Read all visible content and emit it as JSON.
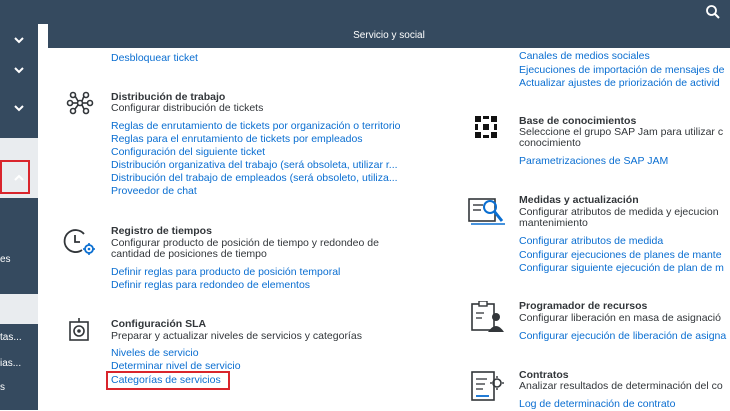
{
  "header": {
    "title": "Servicio y social"
  },
  "colors": {
    "shell": "#354a5f",
    "link": "#0a6ed1",
    "text": "#32363a",
    "highlight": "#d9252c"
  },
  "sidebar": {
    "items": [
      {
        "label": "",
        "icon": "chevron-down-icon"
      },
      {
        "label": "",
        "icon": "chevron-down-icon"
      },
      {
        "label": "",
        "icon": "chevron-down-icon"
      },
      {
        "label": "...",
        "icon": "chevron-down-icon"
      },
      {
        "label": "",
        "icon": "chevron-up-icon"
      }
    ],
    "fragments": [
      "es",
      "tas...",
      "ias...",
      "s"
    ]
  },
  "left_column": {
    "top_links": [
      "Desbloquear ticket"
    ],
    "distribucion": {
      "icon": "network-icon",
      "title": "Distribución de trabajo",
      "subtitle": "Configurar distribución de tickets",
      "links": [
        "Reglas de enrutamiento de tickets por organización o territorio",
        "Reglas para el enrutamiento de tickets por empleados",
        "Configuración del siguiente ticket",
        "Distribución organizativa del trabajo (será obsoleta, utilizar r...",
        "Distribución del trabajo de empleados (será obsoleto, utiliza...",
        "Proveedor de chat"
      ]
    },
    "registro": {
      "icon": "time-settings-icon",
      "title": "Registro de tiempos",
      "subtitle_1": "Configurar producto de posición de tiempo y redondeo de",
      "subtitle_2": "cantidad de posiciones de tiempo",
      "links": [
        "Definir reglas para producto de posición temporal",
        "Definir reglas para redondeo de elementos"
      ]
    },
    "sla": {
      "icon": "target-icon",
      "title": "Configuración SLA",
      "subtitle": "Preparar y actualizar niveles de servicios y categorías",
      "links": [
        "Niveles de servicio",
        "Determinar nivel de servicio",
        "Categorías de servicios"
      ]
    }
  },
  "right_column": {
    "top_links": [
      "Canales de medios sociales",
      "Ejecuciones de importación de mensajes de",
      "Actualizar ajustes de priorización de activid"
    ],
    "conocimientos": {
      "icon": "sap-jam-icon",
      "title": "Base de conocimientos",
      "subtitle_1": "Seleccione el grupo SAP Jam para utilizar c",
      "subtitle_2": "conocimiento",
      "links": [
        "Parametrizaciones de SAP JAM"
      ]
    },
    "medidas": {
      "icon": "measure-icon",
      "title": "Medidas y actualización",
      "subtitle_1": "Configurar atributos de medida y ejecucion",
      "subtitle_2": "mantenimiento",
      "links": [
        "Configurar atributos de medida",
        "Configurar ejecuciones de planes de mante",
        "Configurar siguiente ejecución de plan de m"
      ]
    },
    "programador": {
      "icon": "resource-scheduler-icon",
      "title": "Programador de recursos",
      "subtitle": "Configurar liberación en masa de asignació",
      "links": [
        "Configurar ejecución de liberación de asigna"
      ]
    },
    "contratos": {
      "icon": "contract-icon",
      "title": "Contratos",
      "subtitle": "Analizar resultados de determinación del co",
      "links": [
        "Log de determinación de contrato"
      ]
    }
  }
}
